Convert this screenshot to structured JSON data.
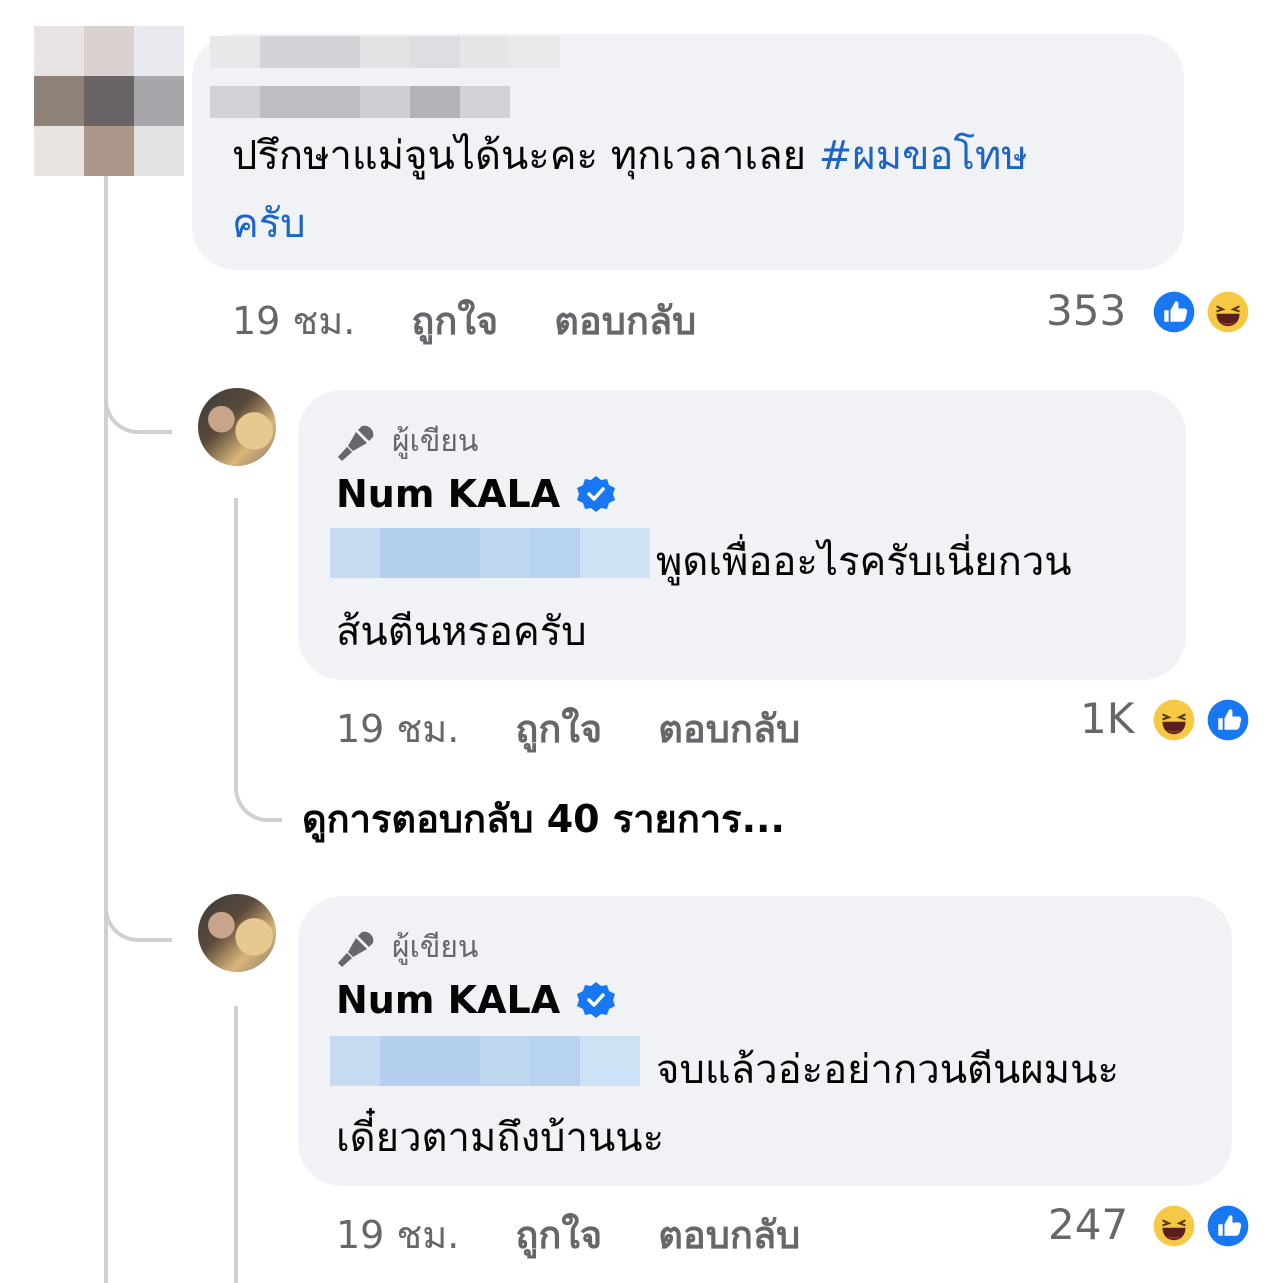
{
  "top_comment": {
    "text_line1": "ปรึกษาแม่จูนได้นะคะ ทุกเวลาเลย",
    "hashtag_part1": "#ผมขอโทษ",
    "hashtag_part2": "ครับ",
    "time": "19 ชม.",
    "like_label": "ถูกใจ",
    "reply_label": "ตอบกลับ",
    "reaction_count": "353",
    "reactions": [
      "like-icon",
      "haha-icon"
    ]
  },
  "replies": [
    {
      "author_badge": "ผู้เขียน",
      "name": "Num KALA",
      "text_line1": "พูดเพื่ออะไรครับเนี่ยกวน",
      "text_line2": "ส้นตีนหรอครับ",
      "time": "19 ชม.",
      "like_label": "ถูกใจ",
      "reply_label": "ตอบกลับ",
      "reaction_count": "1K",
      "reactions": [
        "haha-icon",
        "like-icon"
      ]
    },
    {
      "author_badge": "ผู้เขียน",
      "name": "Num KALA",
      "text_line1": "จบแล้วอ่ะอย่ากวนตีนผมนะ",
      "text_line2": "เดี๋ยวตามถึงบ้านนะ",
      "time": "19 ชม.",
      "like_label": "ถูกใจ",
      "reply_label": "ตอบกลับ",
      "reaction_count": "247",
      "reactions": [
        "haha-icon",
        "like-icon"
      ]
    }
  ],
  "view_more_replies": "ดูการตอบกลับ 40 รายการ...",
  "colors": {
    "bubble": "#f0f2f5",
    "hashtag": "#1b65c9",
    "meta_text": "#65676b",
    "like_blue": "#1877f2",
    "haha_yellow": "#f7c844",
    "thread_line": "#ced0d4"
  }
}
